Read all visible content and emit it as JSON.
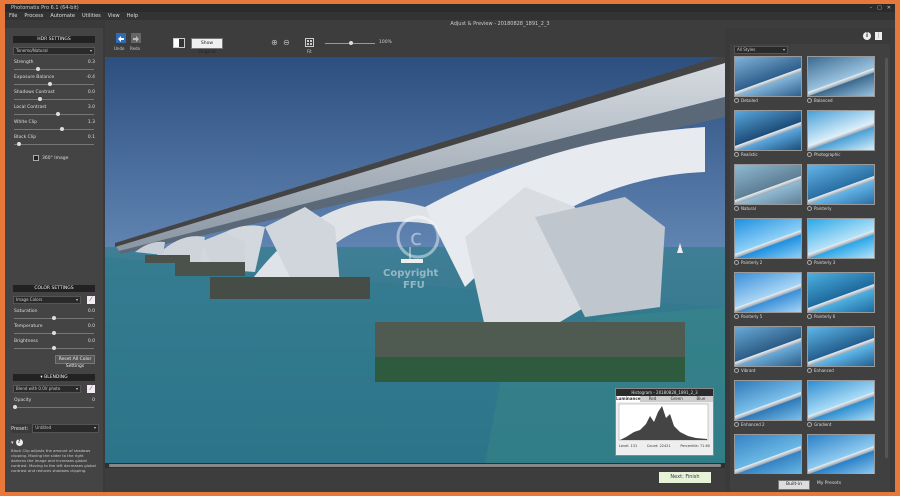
{
  "window": {
    "title": "Photomatix Pro 6.1 (64-bit)",
    "subtitle": "Adjust & Preview - 20180828_1891_2_3"
  },
  "menu": [
    "File",
    "Process",
    "Automate",
    "Utilities",
    "View",
    "Help"
  ],
  "left": {
    "hdr_title": "HDR SETTINGS",
    "preset_dropdown": "Tonemo/Natural",
    "sliders": [
      {
        "label": "Strength",
        "value": "0.3",
        "level": 0.3
      },
      {
        "label": "Exposure Balance",
        "value": "-0.4",
        "level": 0.45
      },
      {
        "label": "Shadows Contrast",
        "value": "0.0",
        "level": 0.32
      },
      {
        "label": "Local Contrast",
        "value": "3.0",
        "level": 0.55
      },
      {
        "label": "White Clip",
        "value": "1.3",
        "level": 0.6
      },
      {
        "label": "Black Clip",
        "value": "0.1",
        "level": 0.05
      }
    ],
    "checkbox_360": "360° Image",
    "color_title": "COLOR SETTINGS",
    "color_dropdown": "Image Colors",
    "color_sliders": [
      {
        "label": "Saturation",
        "value": "0.0",
        "level": 0.5
      },
      {
        "label": "Temperature",
        "value": "0.0",
        "level": 0.5
      },
      {
        "label": "Brightness",
        "value": "0.0",
        "level": 0.5
      }
    ],
    "reset_color": "Reset All Color Settings",
    "blending_title": "BLENDING",
    "blend_dropdown": "Blend with 0.0V photo",
    "opacity_label": "Opacity",
    "opacity_value": "0",
    "preset_label": "Preset:",
    "preset_value": "Untitled",
    "help_text": "Black Clip adjusts the amount of shadows clipping. Moving the slider to the right darkens the image and increases global contrast. Moving to the left decreases global contrast and reduces shadows clipping."
  },
  "toolbar": {
    "undo_label": "Undo",
    "redo_label": "Redo",
    "show_original": "Show Original",
    "fit_label": "Fit",
    "zoom_value": "100%"
  },
  "bottom": {
    "next_finish": "Next: Finish"
  },
  "watermark": {
    "line1": "Copyright",
    "line2": "FFU"
  },
  "right": {
    "filter": "All Styles",
    "styles": [
      "Detailed",
      "Balanced",
      "Realistic",
      "Photographic",
      "Natural",
      "Painterly",
      "Painterly 2",
      "Painterly 3",
      "Painterly 5",
      "Painterly 6",
      "Vibrant",
      "Enhanced",
      "Enhanced 2",
      "Gradient",
      "",
      ""
    ],
    "builtin_tab": "Built-in",
    "mypresets_tab": "My Presets"
  },
  "histogram": {
    "title": "Histogram - 20180828_1891_2_3",
    "tabs": [
      "Luminance",
      "Red",
      "Green",
      "Blue"
    ],
    "level": "Level: 131",
    "count": "Count: 22421",
    "percentile": "Percentile: 71.60"
  },
  "colors": {
    "accent_orange": "#e8773a",
    "next_button": "#e6f3d6"
  }
}
